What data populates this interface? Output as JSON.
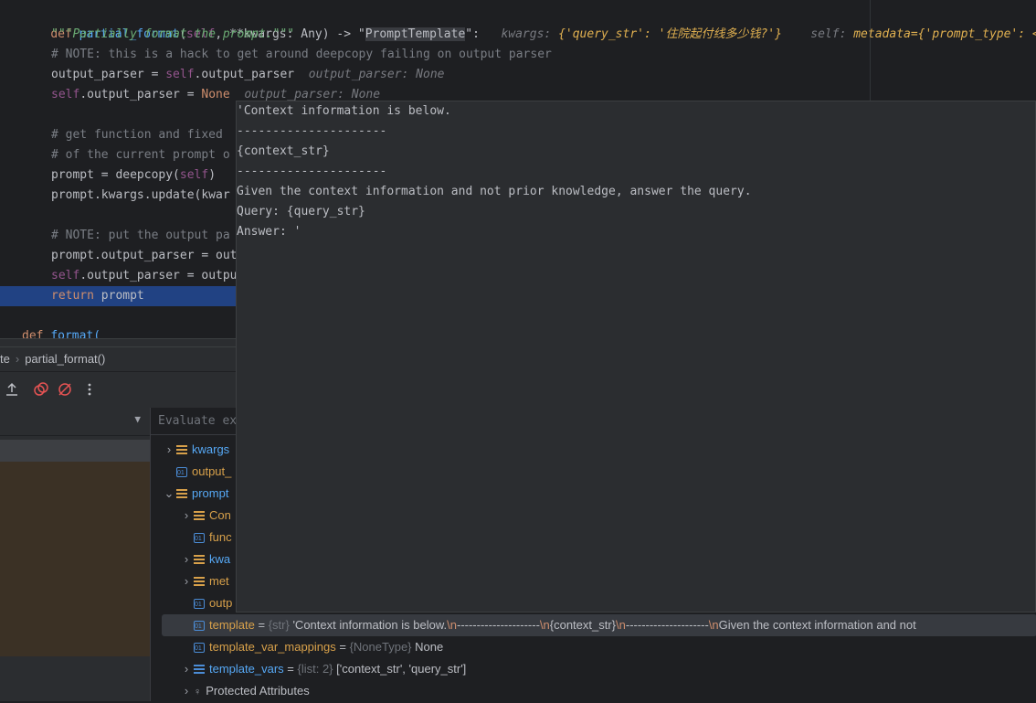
{
  "editor": {
    "lines": {
      "l1_def": "def",
      "l1_name": "partial_format",
      "l1_params_a": "(",
      "l1_self": "self",
      "l1_params_b": ", **kwargs: Any) -> \"",
      "l1_type": "PromptTemplate",
      "l1_end": "\":",
      "l1_hint_label": "kwargs:",
      "l1_hint_value": "{'query_str': '住院起付线多少钱?'}",
      "l1_hint2_label": "self:",
      "l1_hint2_value": "metadata={'prompt_type': <P",
      "l2": "\"\"\"Partially format the prompt.\"\"\"",
      "l3": "# NOTE: this is a hack to get around deepcopy failing on output parser",
      "l4_a": "output_parser = ",
      "l4_self": "self",
      "l4_b": ".output_parser",
      "l4_hint": "output_parser: None",
      "l5_self": "self",
      "l5_b": ".output_parser = ",
      "l5_none": "None",
      "l5_hint": "output_parser: None",
      "l7": "# get function and fixed",
      "l8": "# of the current prompt o",
      "l9_a": "prompt = deepcopy(",
      "l9_self": "self",
      "l9_b": ")",
      "l10": "prompt.kwargs.update(kwar",
      "l12": "# NOTE: put the output pa",
      "l13": "prompt.output_parser = out",
      "l14_self": "self",
      "l14_b": ".output_parser = outpu",
      "l15_kw": "return",
      "l15_b": " prompt",
      "l17_def": "def",
      "l17_name": "format("
    }
  },
  "breadcrumb": {
    "part1": "te",
    "sep": "›",
    "part2": "partial_format()"
  },
  "evaluate": {
    "placeholder": "Evaluate ex"
  },
  "variables": [
    {
      "name": "kwargs",
      "kind": "list",
      "expand": "›"
    },
    {
      "name": "output_",
      "kind": "obj",
      "expand": ""
    },
    {
      "name": "prompt",
      "kind": "list",
      "expand": "⌄"
    },
    {
      "name": "Con",
      "kind": "list",
      "expand": "›"
    },
    {
      "name": "func",
      "kind": "obj",
      "expand": ""
    },
    {
      "name": "kwa",
      "kind": "list",
      "expand": "›"
    },
    {
      "name": "met",
      "kind": "list",
      "expand": "›"
    },
    {
      "name": "outp",
      "kind": "obj",
      "expand": ""
    }
  ],
  "template_row": {
    "name": "template",
    "eq": " = ",
    "type": "{str}",
    "v1": "'Context information is below.",
    "e1": "\\n",
    "v2": "---------------------",
    "e2": "\\n",
    "v3": "{context_str}",
    "e3": "\\n",
    "v4": "---------------------",
    "e4": "\\n",
    "v5": "Given the context information and not"
  },
  "mappings_row": {
    "name": "template_var_mappings",
    "eq": " = ",
    "type": "{NoneType}",
    "value": "None"
  },
  "vars_row": {
    "name": "template_vars",
    "eq": " = ",
    "type": "{list: 2}",
    "value": "['context_str', 'query_str']"
  },
  "protected_row": {
    "name": "Protected Attributes"
  },
  "popup": {
    "lines": [
      "'Context information is below.",
      "---------------------",
      "{context_str}",
      "---------------------",
      "Given the context information and not prior knowledge, answer the query.",
      "Query: {query_str}",
      "Answer: '"
    ]
  },
  "colors": {
    "accent": "#214283",
    "keyword": "#cf8e6d",
    "function": "#56a8f5",
    "string": "#6aab73"
  }
}
